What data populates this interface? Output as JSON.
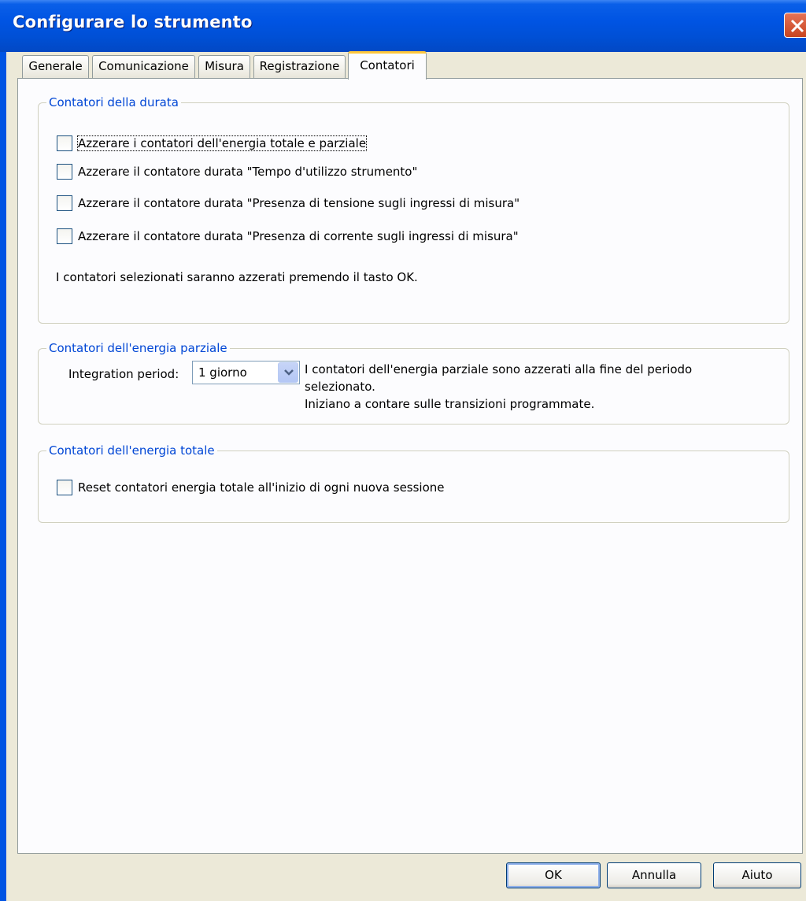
{
  "window": {
    "title": "Configurare lo strumento"
  },
  "tabs": [
    {
      "label": "Generale",
      "active": false
    },
    {
      "label": "Comunicazione",
      "active": false
    },
    {
      "label": "Misura",
      "active": false
    },
    {
      "label": "Registrazione",
      "active": false
    },
    {
      "label": "Contatori",
      "active": true
    }
  ],
  "durata": {
    "legend": "Contatori della durata",
    "checkboxes": [
      {
        "label": "Azzerare i contatori dell'energia totale e parziale",
        "checked": false
      },
      {
        "label": "Azzerare il contatore durata \"Tempo d'utilizzo strumento\"",
        "checked": false
      },
      {
        "label": "Azzerare il contatore durata \"Presenza di tensione sugli ingressi di misura\"",
        "checked": false
      },
      {
        "label": "Azzerare il contatore durata \"Presenza di corrente sugli ingressi di misura\"",
        "checked": false
      }
    ],
    "note": "I contatori selezionati saranno azzerati premendo il tasto OK."
  },
  "parziale": {
    "legend": "Contatori dell'energia parziale",
    "period_label": "Integration period:",
    "period_value": "1 giorno",
    "info_line1": "I contatori dell'energia parziale sono azzerati alla fine del periodo",
    "info_line2": "selezionato.",
    "info_line3": "Iniziano a contare sulle transizioni programmate."
  },
  "totale": {
    "legend": "Contatori dell'energia totale",
    "checkbox": {
      "label": "Reset contatori energia totale all'inizio di ogni nuova sessione",
      "checked": false
    }
  },
  "buttons": {
    "ok": "OK",
    "cancel": "Annulla",
    "help": "Aiuto"
  }
}
